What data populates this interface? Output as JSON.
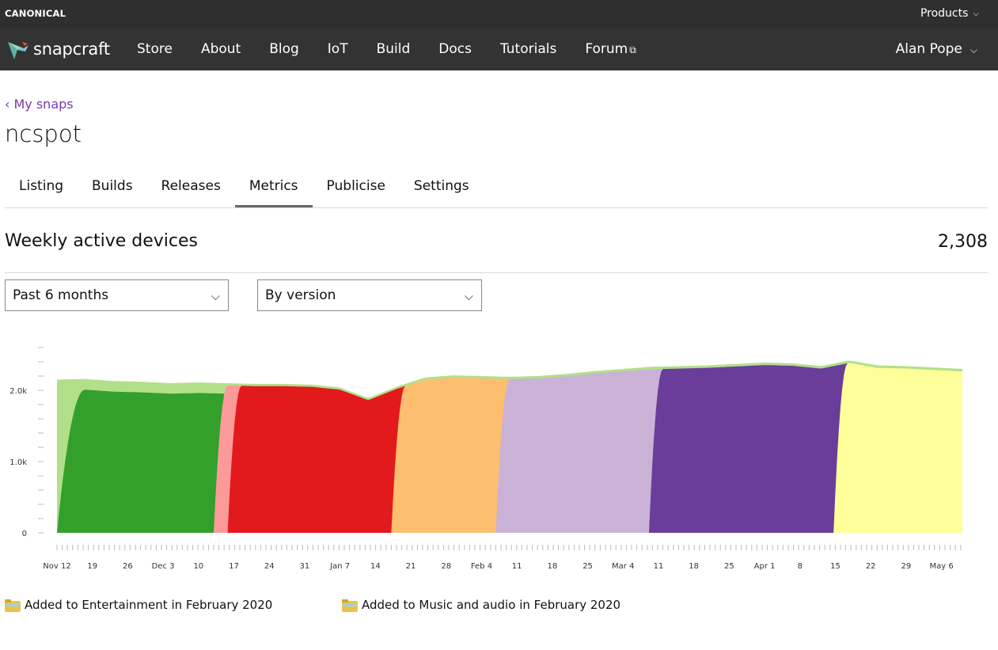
{
  "topbar": {
    "brand": "CANONICAL",
    "products_label": "Products"
  },
  "navbar": {
    "logo_text": "snapcraft",
    "items": [
      "Store",
      "About",
      "Blog",
      "IoT",
      "Build",
      "Docs",
      "Tutorials",
      "Forum"
    ],
    "user_name": "Alan Pope"
  },
  "page": {
    "back_link": "‹ My snaps",
    "snap_name": "ncspot",
    "tabs": [
      "Listing",
      "Builds",
      "Releases",
      "Metrics",
      "Publicise",
      "Settings"
    ],
    "active_tab": "Metrics"
  },
  "metric": {
    "title": "Weekly active devices",
    "value": "2,308",
    "period_select": "Past 6 months",
    "group_select": "By version"
  },
  "chart_data": {
    "type": "area",
    "stacked": true,
    "ylim": [
      0,
      2600
    ],
    "yticks": [
      "0",
      "1.0k",
      "2.0k"
    ],
    "ytick_values": [
      0,
      1000,
      2000
    ],
    "xticks": [
      "Nov 12",
      "19",
      "26",
      "Dec 3",
      "10",
      "17",
      "24",
      "31",
      "Jan 7",
      "14",
      "21",
      "28",
      "Feb 4",
      "11",
      "18",
      "25",
      "Mar 4",
      "11",
      "18",
      "25",
      "Apr 1",
      "8",
      "15",
      "22",
      "29",
      "May 6"
    ],
    "x_start": "Nov 12",
    "days": 181,
    "series": [
      {
        "color": "#b2df8a",
        "values": [
          1200,
          1580,
          1740,
          1890,
          2000,
          2060,
          2070,
          2080,
          2080,
          2040,
          20,
          0,
          0,
          0,
          0,
          0,
          0,
          0,
          0,
          0,
          0,
          0,
          0,
          0,
          0,
          0,
          0,
          0,
          0,
          0
        ]
      },
      {
        "color": "#33a02c",
        "values": [
          0,
          0,
          0,
          0,
          0,
          0,
          0,
          0,
          0,
          0,
          0,
          0,
          0,
          0,
          0,
          0,
          0,
          0,
          0,
          0,
          0,
          0,
          0,
          0,
          0,
          0,
          0,
          0,
          0,
          0
        ]
      },
      {
        "color": "#fb9a99",
        "values": [
          0,
          0,
          0,
          0,
          0,
          0,
          0,
          0,
          0,
          0,
          0,
          0,
          0,
          0,
          0,
          0,
          0,
          0,
          0,
          0,
          0,
          0,
          0,
          0,
          0,
          0,
          0,
          0,
          0,
          0
        ]
      },
      {
        "color": "#e31a1c",
        "values": [
          0,
          0,
          0,
          0,
          0,
          0,
          0,
          0,
          0,
          0,
          0,
          0,
          0,
          0,
          0,
          0,
          0,
          0,
          0,
          0,
          0,
          0,
          0,
          0,
          0,
          0,
          0,
          0,
          0,
          0
        ]
      },
      {
        "color": "#fdbf6f",
        "values": [
          0,
          0,
          0,
          0,
          0,
          0,
          0,
          0,
          0,
          0,
          0,
          0,
          0,
          0,
          0,
          0,
          0,
          0,
          0,
          0,
          0,
          0,
          0,
          0,
          0,
          0,
          0,
          0,
          0,
          0
        ]
      },
      {
        "color": "#cab2d6",
        "values": [
          0,
          0,
          0,
          0,
          0,
          0,
          0,
          0,
          0,
          0,
          0,
          0,
          0,
          0,
          0,
          0,
          0,
          0,
          0,
          0,
          0,
          0,
          0,
          0,
          0,
          0,
          0,
          0,
          0,
          0
        ]
      },
      {
        "color": "#6a3d9a",
        "values": [
          0,
          0,
          0,
          0,
          0,
          0,
          0,
          0,
          0,
          0,
          0,
          0,
          0,
          0,
          0,
          0,
          0,
          0,
          0,
          0,
          0,
          0,
          0,
          0,
          0,
          0,
          0,
          0,
          0,
          0
        ]
      },
      {
        "color": "#ffff99",
        "values": [
          0,
          0,
          0,
          0,
          0,
          0,
          0,
          0,
          0,
          0,
          0,
          0,
          0,
          0,
          0,
          0,
          0,
          0,
          0,
          0,
          0,
          0,
          0,
          0,
          0,
          0,
          0,
          0,
          0,
          0
        ]
      },
      {
        "color": "#b15928",
        "values": [
          0,
          0,
          0,
          0,
          0,
          0,
          0,
          0,
          0,
          0,
          0,
          0,
          0,
          0,
          0,
          0,
          0,
          0,
          0,
          0,
          0,
          0,
          0,
          0,
          0,
          0,
          0,
          0,
          0,
          0
        ]
      }
    ],
    "version_waves": [
      {
        "color": "#33a02c",
        "start_day": 0,
        "end_day": 45,
        "level": 1950
      },
      {
        "color": "#fb9a99",
        "start_day": 45,
        "end_day": 49,
        "level": 1900
      },
      {
        "color": "#e31a1c",
        "start_day": 49,
        "end_day": 96,
        "level": 2200
      },
      {
        "color": "#fdbf6f",
        "start_day": 96,
        "end_day": 126,
        "level": 2200
      },
      {
        "color": "#cab2d6",
        "start_day": 126,
        "end_day": 170,
        "level": 2300
      },
      {
        "color": "#6a3d9a",
        "start_day": 170,
        "end_day": 223,
        "level": 2350
      },
      {
        "color": "#ffff99",
        "start_day": 223,
        "end_day": 260,
        "level": 2280
      },
      {
        "color": "#b15928",
        "start_day": 260,
        "end_day": 261,
        "level": 650
      }
    ],
    "total": [
      2150,
      2160,
      2130,
      2120,
      2100,
      2110,
      2100,
      2090,
      2090,
      2080,
      2040,
      1890,
      2050,
      2180,
      2210,
      2200,
      2190,
      2200,
      2230,
      2270,
      2300,
      2330,
      2340,
      2350,
      2370,
      2390,
      2380,
      2340,
      2420,
      2350,
      2340,
      2320,
      2300
    ]
  },
  "annotations": [
    {
      "prefix": "Added to",
      "category": "Entertainment",
      "mid": "in",
      "date": "February 2020"
    },
    {
      "prefix": "Added to",
      "category": "Music and audio",
      "mid": "in",
      "date": "February 2020"
    }
  ]
}
